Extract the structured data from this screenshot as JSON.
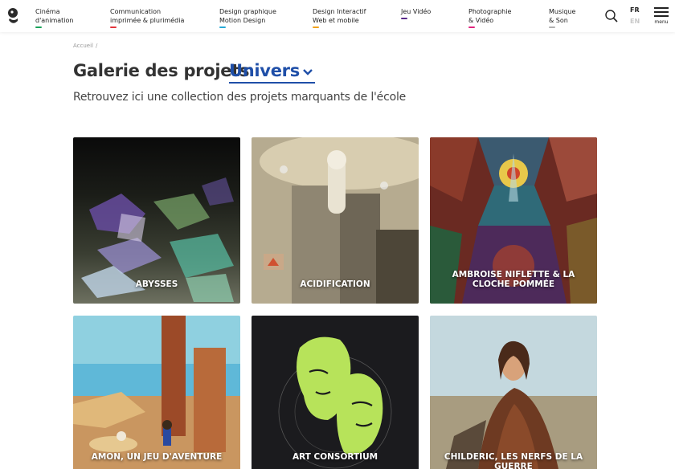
{
  "header": {
    "nav": [
      {
        "line1": "Cinéma",
        "line2": "d'animation",
        "color": "#1aa35a"
      },
      {
        "line1": "Communication",
        "line2": "imprimée & plurimédia",
        "color": "#e3343c"
      },
      {
        "line1": "Design graphique",
        "line2": "Motion Design",
        "color": "#27a9d6"
      },
      {
        "line1": "Design Interactif",
        "line2": "Web et mobile",
        "color": "#f0a21c"
      },
      {
        "line1": "Jeu Vidéo",
        "line2": "",
        "color": "#5a2a8a"
      },
      {
        "line1": "Photographie",
        "line2": "& Vidéo",
        "color": "#e0257e"
      },
      {
        "line1": "Musique",
        "line2": "& Son",
        "color": "#b0b0b0"
      }
    ],
    "lang_fr": "FR",
    "lang_en": "EN",
    "menu_label": "menu"
  },
  "breadcrumb": {
    "home": "Accueil",
    "sep": "/"
  },
  "title": {
    "prefix": "Galerie des projets",
    "selected": "Univers"
  },
  "subtitle": "Retrouvez ici une collection des projets marquants de l'école",
  "projects": [
    {
      "title": "ABYSSES"
    },
    {
      "title": "ACIDIFICATION"
    },
    {
      "title": "AMBROISE NIFLETTE & LA CLOCHE POMMÉE"
    },
    {
      "title": "AMON, UN JEU D'AVENTURE"
    },
    {
      "title": "ART CONSORTIUM"
    },
    {
      "title": "CHILDERIC, LES NERFS DE LA GUERRE"
    }
  ],
  "colors": {
    "accent": "#1f4fa8"
  }
}
